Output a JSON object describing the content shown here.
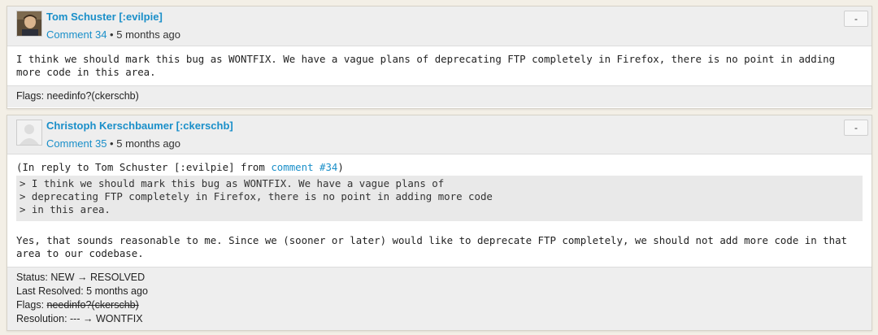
{
  "comments": [
    {
      "author": "Tom Schuster [:evilpie]",
      "comment_label": "Comment 34",
      "separator": "•",
      "time": "5 months ago",
      "collapse_label": "-",
      "body": "I think we should mark this bug as WONTFIX. We have a vague plans of deprecating FTP completely in Firefox, there is no point in adding more code in this area.",
      "footer": "Flags: needinfo?(ckerschb)"
    },
    {
      "author": "Christoph Kerschbaumer [:ckerschb]",
      "comment_label": "Comment 35",
      "separator": "•",
      "time": "5 months ago",
      "collapse_label": "-",
      "reply_prefix": "(In reply to Tom Schuster [:evilpie] from ",
      "reply_link": "comment #34",
      "reply_suffix": ")",
      "quote_lines": [
        "> I think we should mark this bug as WONTFIX. We have a vague plans of",
        "> deprecating FTP completely in Firefox, there is no point in adding more code",
        "> in this area."
      ],
      "body": "Yes, that sounds reasonable to me. Since we (sooner or later) would like to deprecate FTP completely, we should not add more code in that area to our codebase.",
      "status_line": "Status: NEW → RESOLVED",
      "last_resolved_line": "Last Resolved: 5 months ago",
      "flags_label": "Flags: ",
      "flags_value": "needinfo?(ckerschb)",
      "resolution_line": "Resolution: --- → WONTFIX"
    }
  ]
}
